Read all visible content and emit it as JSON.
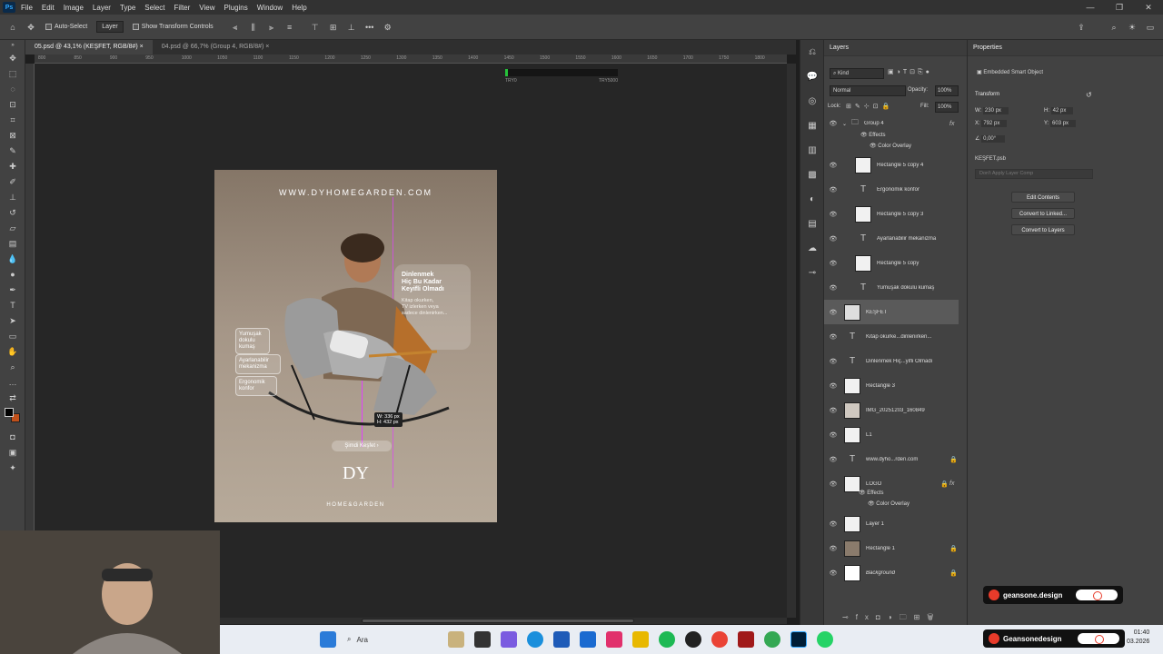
{
  "menu": [
    "File",
    "Edit",
    "Image",
    "Layer",
    "Type",
    "Select",
    "Filter",
    "View",
    "Plugins",
    "Window",
    "Help"
  ],
  "app_logo": "Ps",
  "options": {
    "auto_select": "Auto-Select",
    "target": "Layer",
    "show_transform": "Show Transform Controls"
  },
  "tabs": [
    "05.psd @ 43,1% (KEŞFET, RGB/8#)",
    "04.psd @ 66,7% (Group 4, RGB/8#)"
  ],
  "ruler_ticks": [
    "800",
    "850",
    "900",
    "950",
    "1000",
    "1050",
    "1100",
    "1150",
    "1200",
    "1250",
    "1300",
    "1350",
    "1400",
    "1450",
    "1500",
    "1550",
    "1600",
    "1650",
    "1700",
    "1750",
    "1800"
  ],
  "transport": {
    "left": "TRY0",
    "right": "TRY5000"
  },
  "poster": {
    "url": "WWW.DYHOMEGARDEN.COM",
    "headline": [
      "Dinlenmek",
      "Hiç Bu Kadar",
      "Keyifli Olmadı"
    ],
    "sub": [
      "Kitap okurken,",
      "TV izlerken veya",
      "sadece dinlenirken..."
    ],
    "features": [
      [
        "Yumuşak",
        "dokulu",
        "kumaş"
      ],
      [
        "Ayarlanabilir",
        "mekanizma"
      ],
      [
        "Ergonomik",
        "konfor"
      ]
    ],
    "cta": "Şimdi Keşfet",
    "measure": [
      "W: 336 px",
      "H: 432 px"
    ],
    "brand_mark": "DY",
    "brand_name": "HOME&GARDEN"
  },
  "layers_panel": {
    "title": "Layers",
    "kind": "Kind",
    "blend": "Normal",
    "opacity_label": "Opacity:",
    "opacity": "100%",
    "lock_label": "Lock:",
    "fill_label": "Fill:",
    "fill": "100%",
    "items": [
      {
        "name": "Group 4",
        "type": "group",
        "fx": true
      },
      {
        "name": "Effects",
        "type": "sub"
      },
      {
        "name": "Color Overlay",
        "type": "sub2"
      },
      {
        "name": "Rectangle 5 copy 4",
        "type": "smart"
      },
      {
        "name": "Ergonomik konfor",
        "type": "text"
      },
      {
        "name": "Rectangle 5 copy 3",
        "type": "smart"
      },
      {
        "name": "Ayarlanabilir mekanizma",
        "type": "text"
      },
      {
        "name": "Rectangle 5 copy",
        "type": "smart"
      },
      {
        "name": "Yumuşak dokulu kumaş",
        "type": "text"
      },
      {
        "name": "KEŞFET",
        "type": "smart",
        "selected": true
      },
      {
        "name": "Kitap okurke...dinlenirken...",
        "type": "text"
      },
      {
        "name": "Dinlenmek Hiç...yifli Olmadı",
        "type": "text"
      },
      {
        "name": "Rectangle 3",
        "type": "smart"
      },
      {
        "name": "IMG_20251203_160849",
        "type": "smart"
      },
      {
        "name": "L1",
        "type": "smart"
      },
      {
        "name": "www.dyho...rden.com",
        "type": "text",
        "lock": true
      },
      {
        "name": "LOGO",
        "type": "smart",
        "lock": true,
        "fx": true
      },
      {
        "name": "Effects",
        "type": "sub"
      },
      {
        "name": "Color Overlay",
        "type": "sub2"
      },
      {
        "name": "Layer 1",
        "type": "pixel"
      },
      {
        "name": "Rectangle 1",
        "type": "smart",
        "lock": true
      },
      {
        "name": "Background",
        "type": "bg",
        "lock": true
      }
    ]
  },
  "properties_panel": {
    "title": "Properties",
    "object_type": "Embedded Smart Object",
    "section": "Transform",
    "w_label": "W:",
    "w": "230 px",
    "h_label": "H:",
    "h": "42 px",
    "x_label": "X:",
    "x": "792 px",
    "y_label": "Y:",
    "y": "603 px",
    "angle": "0,00°",
    "file": "KEŞFET.psb",
    "comp": "Don't Apply Layer Comp",
    "buttons": [
      "Edit Contents",
      "Convert to Linked...",
      "Convert to Layers"
    ]
  },
  "taskbar": {
    "search": "Ara",
    "time": "01:40",
    "date": "03.2026"
  },
  "banners": [
    "geansone.design",
    "Geansonedesign"
  ],
  "colors": {
    "accent": "#31a8ff",
    "panel": "#424242",
    "canvas": "#262626"
  }
}
